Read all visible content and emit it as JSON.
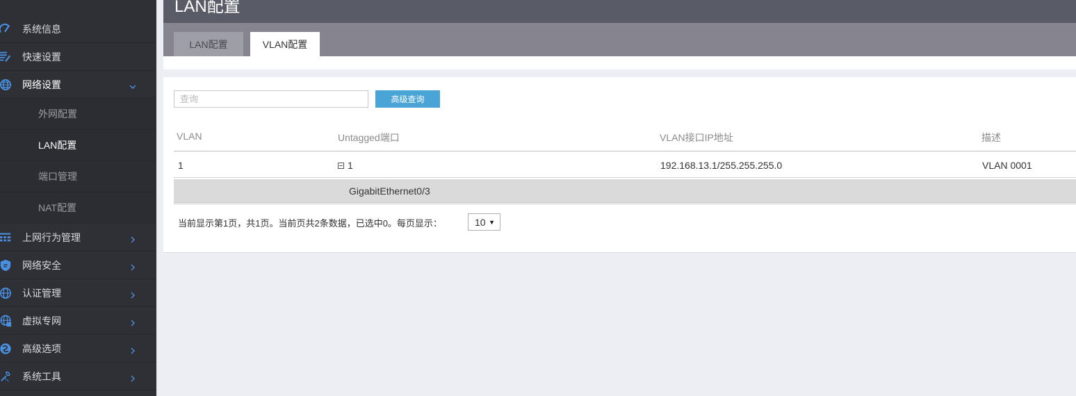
{
  "sidebar": {
    "items": [
      {
        "label": "系统信息",
        "icon": "speedometer-icon"
      },
      {
        "label": "快速设置",
        "icon": "edit-list-icon"
      },
      {
        "label": "网络设置",
        "icon": "globe-icon"
      },
      {
        "label": "上网行为管理",
        "icon": "grid-icon"
      },
      {
        "label": "网络安全",
        "icon": "shield-icon"
      },
      {
        "label": "认证管理",
        "icon": "globe-icon"
      },
      {
        "label": "虚拟专网",
        "icon": "vpn-globe-icon"
      },
      {
        "label": "高级选项",
        "icon": "settings-circle-icon"
      },
      {
        "label": "系统工具",
        "icon": "tools-icon"
      }
    ],
    "sub_items": [
      {
        "label": "外网配置"
      },
      {
        "label": "LAN配置"
      },
      {
        "label": "端口管理"
      },
      {
        "label": "NAT配置"
      }
    ]
  },
  "header": {
    "title": "LAN配置"
  },
  "tabs": [
    {
      "label": "LAN配置"
    },
    {
      "label": "VLAN配置"
    }
  ],
  "search": {
    "placeholder": "查询",
    "advanced_label": "高级查询"
  },
  "table": {
    "headers": [
      "VLAN",
      "Untagged端口",
      "VLAN接口IP地址",
      "描述"
    ],
    "row": {
      "vlan": "1",
      "untagged": "1",
      "ip": "192.168.13.1/255.255.255.0",
      "desc": "VLAN 0001"
    },
    "subrow": {
      "port": "GigabitEthernet0/3"
    }
  },
  "pager": {
    "text": "当前显示第1页，共1页。当前页共2条数据，已选中0。每页显示：",
    "page_size": "10"
  },
  "colors": {
    "accent": "#4aa5d6",
    "sidebar_bg": "#2e3036",
    "icon_blue": "#4a90e2"
  }
}
